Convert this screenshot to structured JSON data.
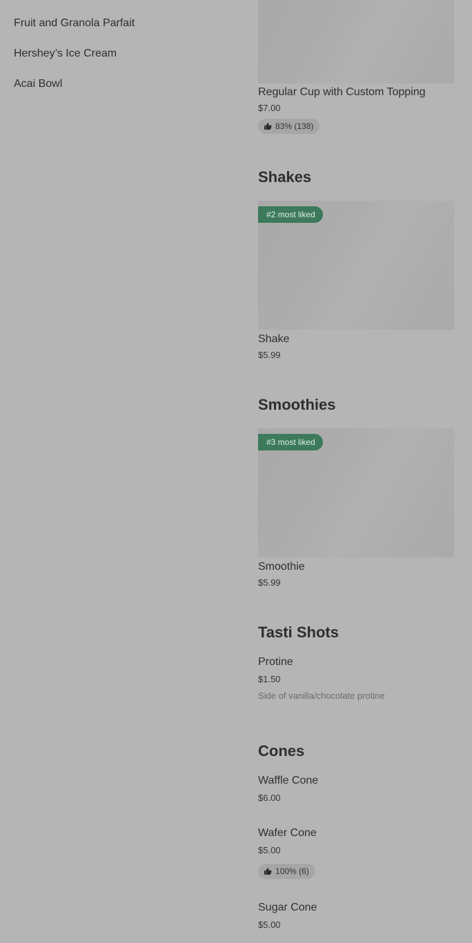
{
  "sidebar": {
    "items": [
      {
        "label": "Fruit and Granola Parfait"
      },
      {
        "label": "Hershey’s Ice Cream"
      },
      {
        "label": "Acai Bowl"
      }
    ]
  },
  "menu": {
    "top_item": {
      "name": "Regular Cup with Custom Topping",
      "price": "$7.00",
      "rating": "83% (138)"
    },
    "shakes": {
      "title": "Shakes",
      "badge": "#2 most liked",
      "name": "Shake",
      "price": "$5.99"
    },
    "smoothies": {
      "title": "Smoothies",
      "badge": "#3 most liked",
      "name": "Smoothie",
      "price": "$5.99"
    },
    "tasti_shots": {
      "title": "Tasti Shots",
      "name": "Protine",
      "price": "$1.50",
      "description": "Side of vanilla/chocolate protine"
    },
    "cones": {
      "title": "Cones",
      "items": [
        {
          "name": "Waffle Cone",
          "price": "$6.00"
        },
        {
          "name": "Wafer Cone",
          "price": "$5.00",
          "rating": "100% (6)"
        },
        {
          "name": "Sugar Cone",
          "price": "$5.00"
        }
      ]
    }
  },
  "colors": {
    "background": "#b5b5b5",
    "badge": "#3c7a5b",
    "image_placeholder": "#adadad",
    "rating_pill": "#a6a6a6"
  },
  "icons": {
    "rating": "thumbs-up-icon"
  }
}
